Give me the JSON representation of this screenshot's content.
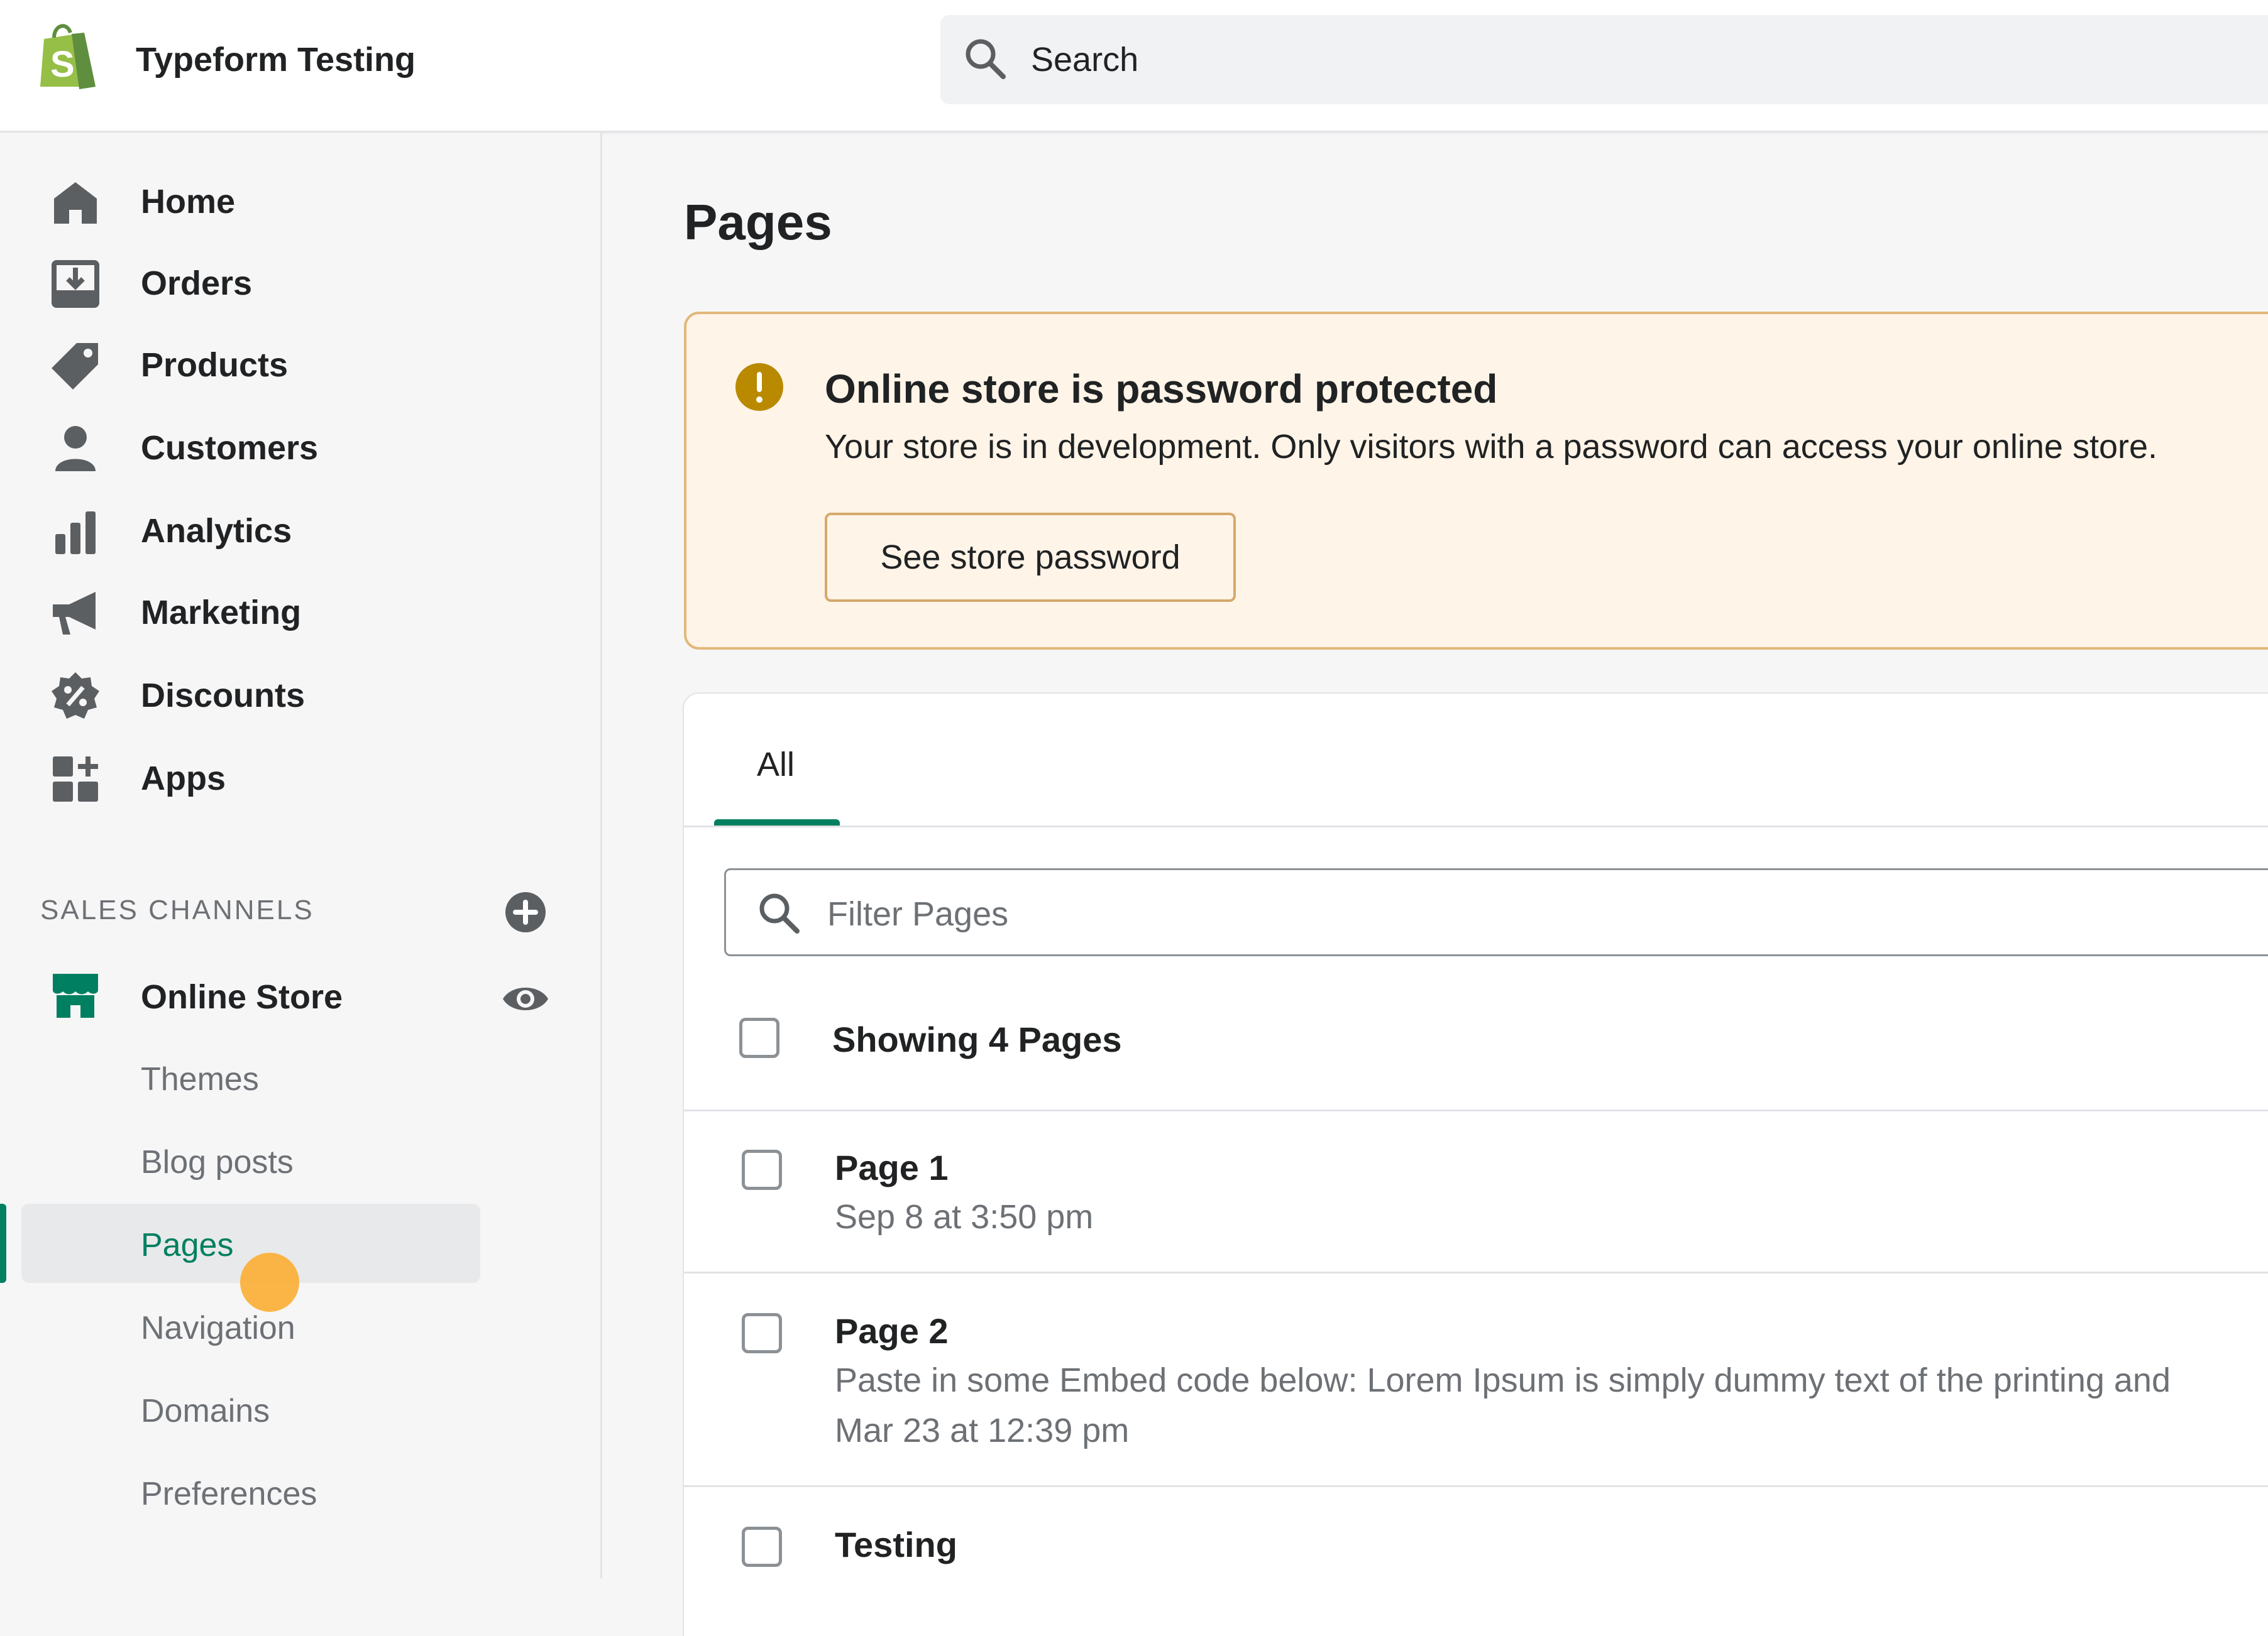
{
  "app": {
    "store_name": "Typeform Testing",
    "logo_icon": "shopify-bag-icon",
    "brand_color": "#95bf47",
    "accent_color": "#008060"
  },
  "search": {
    "placeholder": "Search"
  },
  "sidebar": {
    "items": [
      {
        "label": "Home",
        "icon": "home-icon"
      },
      {
        "label": "Orders",
        "icon": "orders-icon"
      },
      {
        "label": "Products",
        "icon": "tag-icon"
      },
      {
        "label": "Customers",
        "icon": "person-icon"
      },
      {
        "label": "Analytics",
        "icon": "bar-chart-icon"
      },
      {
        "label": "Marketing",
        "icon": "megaphone-icon"
      },
      {
        "label": "Discounts",
        "icon": "discount-badge-icon"
      },
      {
        "label": "Apps",
        "icon": "apps-grid-icon"
      }
    ],
    "sales_channels_label": "SALES CHANNELS",
    "online_store": {
      "label": "Online Store",
      "sub_items": [
        {
          "label": "Themes"
        },
        {
          "label": "Blog posts"
        },
        {
          "label": "Pages",
          "active": true
        },
        {
          "label": "Navigation"
        },
        {
          "label": "Domains"
        },
        {
          "label": "Preferences"
        }
      ]
    }
  },
  "main": {
    "title": "Pages",
    "banner": {
      "title": "Online store is password protected",
      "body": "Your store is in development. Only visitors with a password can access your online store.",
      "button_label": "See store password",
      "status": "warning"
    },
    "tabs": [
      {
        "label": "All",
        "selected": true
      }
    ],
    "filter": {
      "placeholder": "Filter Pages"
    },
    "showing_label": "Showing 4 Pages",
    "rows": [
      {
        "title": "Page 1",
        "lines": [
          "Sep 8 at 3:50 pm"
        ]
      },
      {
        "title": "Page 2",
        "lines": [
          "Paste in some Embed code below: Lorem Ipsum is simply dummy text of the printing and",
          "Mar 23 at 12:39 pm"
        ]
      },
      {
        "title": "Testing",
        "lines": []
      }
    ]
  }
}
